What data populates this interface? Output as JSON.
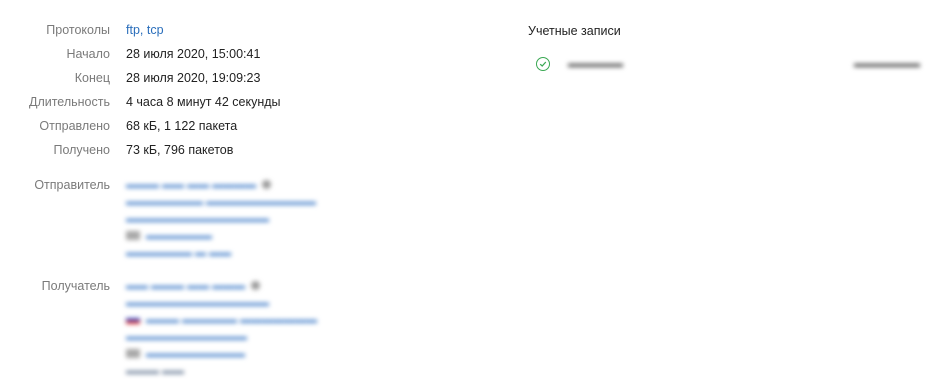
{
  "details": {
    "protocols_label": "Протоколы",
    "protocols_value": "ftp, tcp",
    "start_label": "Начало",
    "start_value": "28 июля 2020, 15:00:41",
    "end_label": "Конец",
    "end_value": "28 июля 2020, 19:09:23",
    "duration_label": "Длительность",
    "duration_value": "4 часа 8 минут 42 секунды",
    "sent_label": "Отправлено",
    "sent_value": "68 кБ, 1 122 пакета",
    "received_label": "Получено",
    "received_value": "73 кБ, 796 пакетов",
    "sender_label": "Отправитель",
    "receiver_label": "Получатель"
  },
  "accounts": {
    "title": "Учетные записи"
  }
}
